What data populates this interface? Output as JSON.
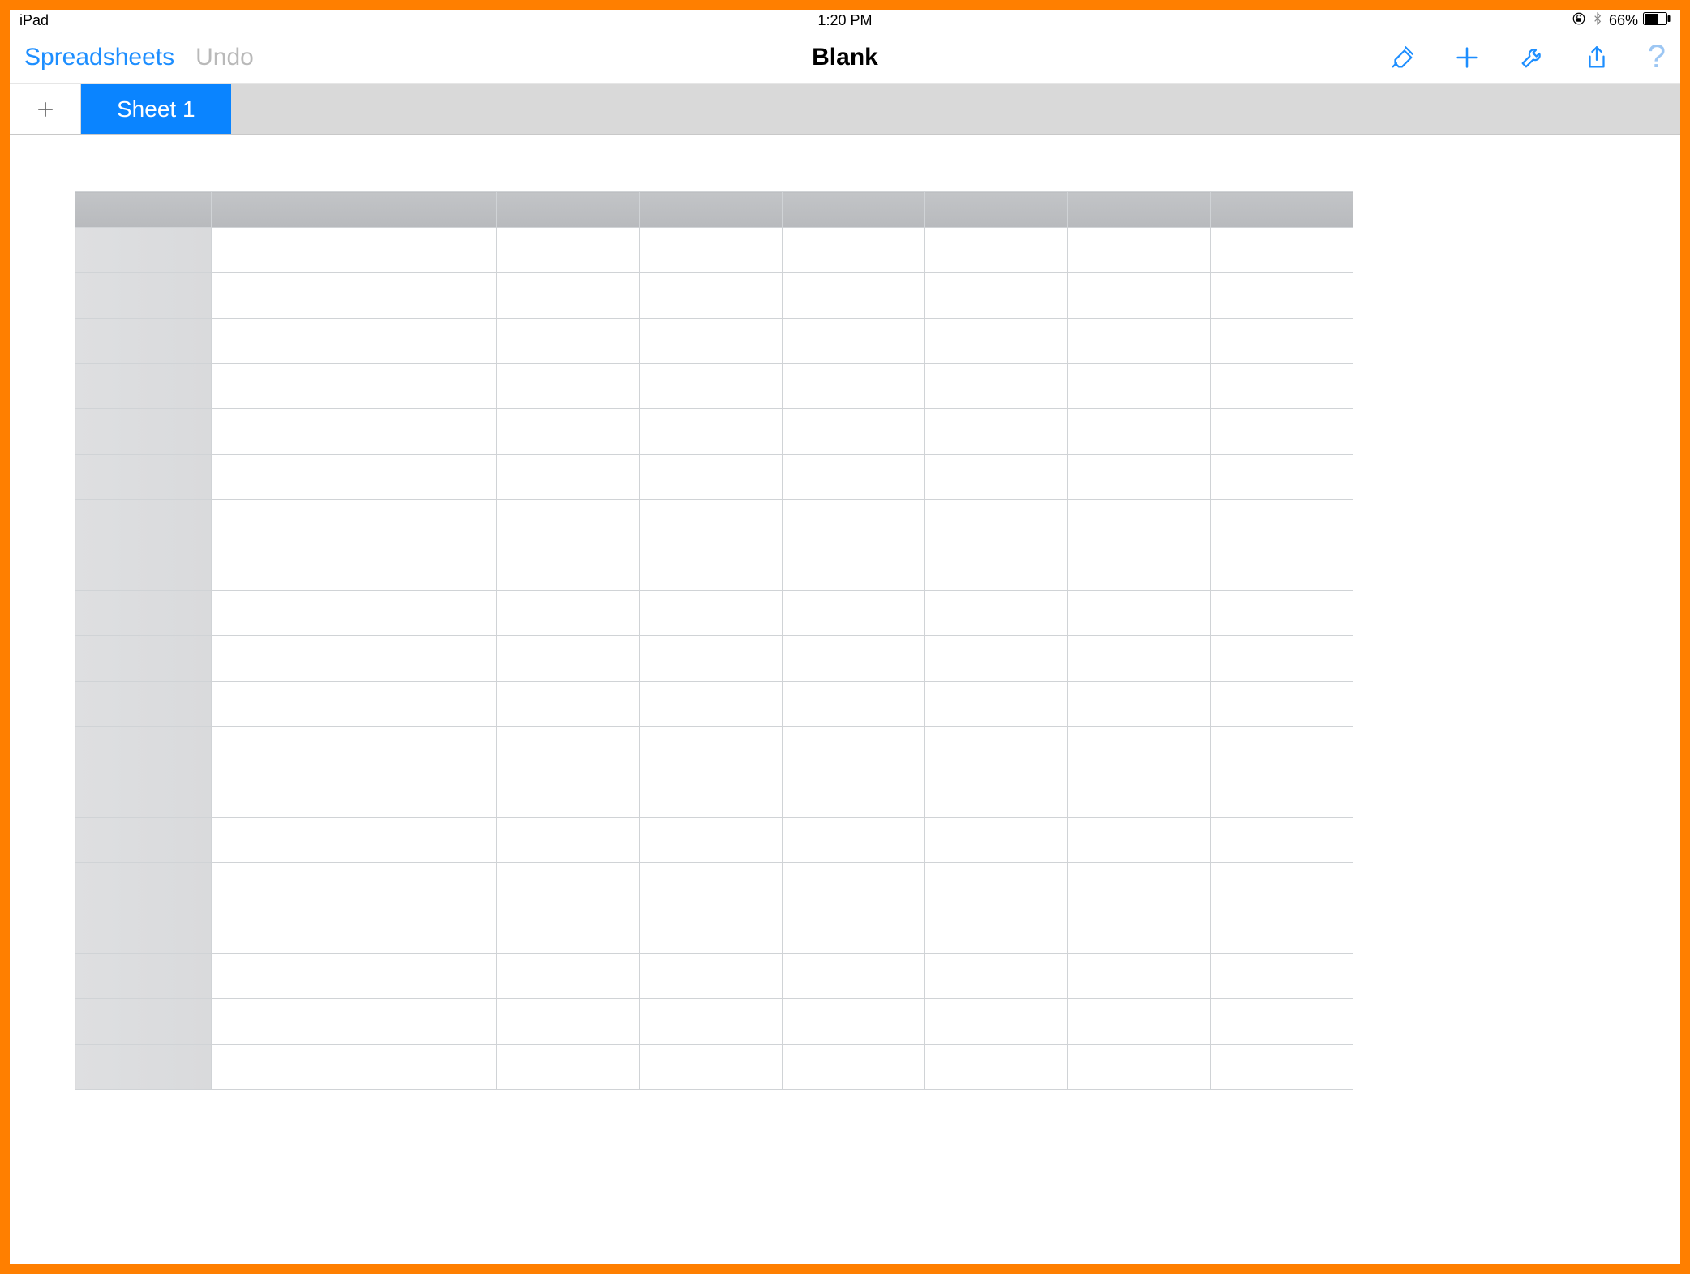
{
  "status": {
    "device": "iPad",
    "time": "1:20 PM",
    "lock_icon": "orientation-lock-icon",
    "bluetooth_icon": "bluetooth-icon",
    "battery_percent": "66%",
    "battery_icon": "battery-icon"
  },
  "toolbar": {
    "back_label": "Spreadsheets",
    "undo_label": "Undo",
    "title": "Blank",
    "icons": {
      "format": "paintbrush-icon",
      "add": "plus-icon",
      "tools": "wrench-icon",
      "share": "share-icon",
      "help": "help-icon"
    }
  },
  "sheets": {
    "add_icon": "plus-icon",
    "active_tab": "Sheet 1"
  },
  "grid": {
    "columns": 8,
    "rows": 19,
    "column_labels": [
      "",
      "",
      "",
      "",
      "",
      "",
      "",
      ""
    ],
    "row_labels": [
      "",
      "",
      "",
      "",
      "",
      "",
      "",
      "",
      "",
      "",
      "",
      "",
      "",
      "",
      "",
      "",
      "",
      "",
      ""
    ],
    "cells": []
  },
  "colors": {
    "accent": "#1d8eff",
    "tab_active": "#0a84ff",
    "frame": "#ff7f00"
  }
}
